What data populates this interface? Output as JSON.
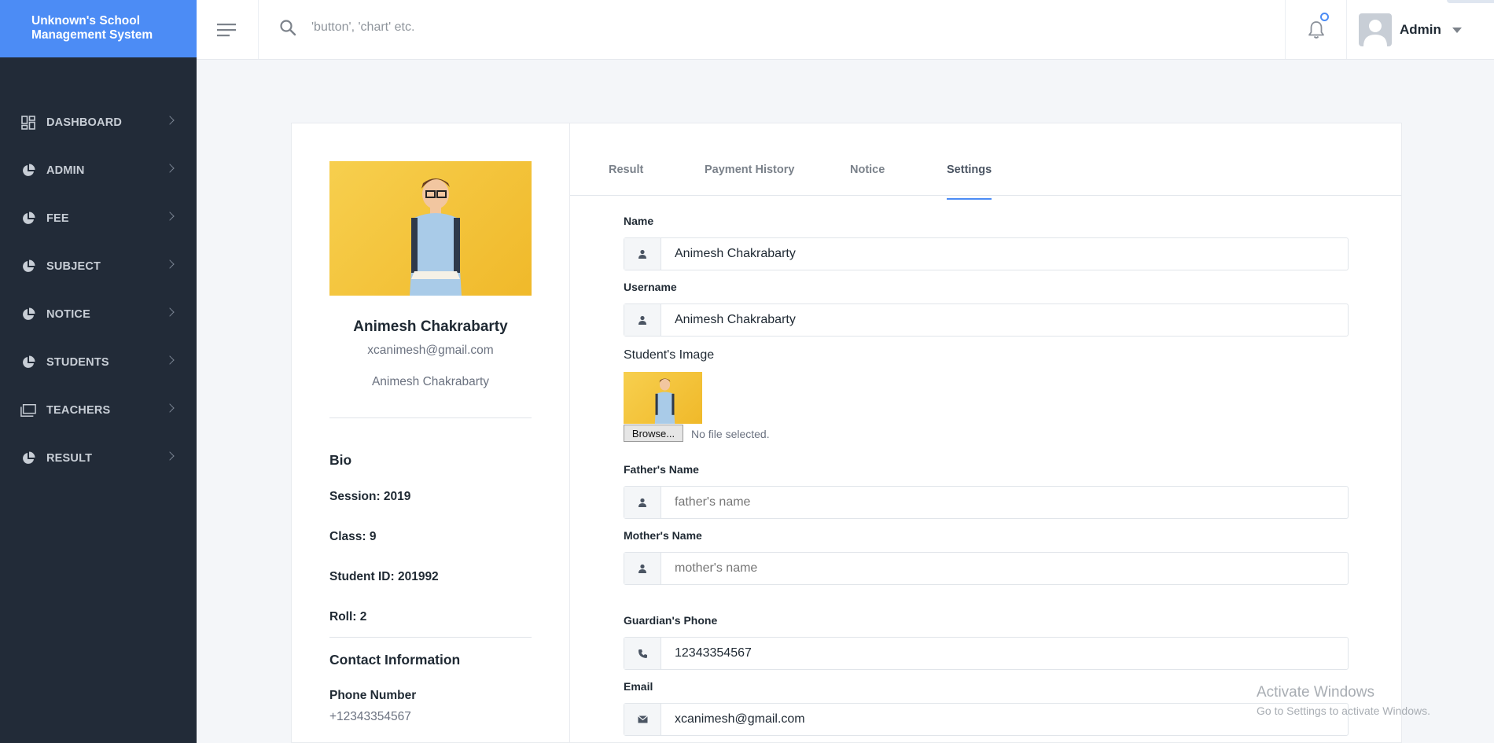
{
  "app": {
    "title_line1": "Unknown's School",
    "title_line2": "Management System"
  },
  "topbar": {
    "search_placeholder": "'button', 'chart' etc.",
    "user_name": "Admin"
  },
  "sidebar": {
    "items": [
      {
        "label": "DASHBOARD",
        "icon": "dashboard-grid-icon"
      },
      {
        "label": "ADMIN",
        "icon": "pie-chart-icon"
      },
      {
        "label": "FEE",
        "icon": "pie-chart-icon"
      },
      {
        "label": "SUBJECT",
        "icon": "pie-chart-icon"
      },
      {
        "label": "NOTICE",
        "icon": "pie-chart-icon"
      },
      {
        "label": "STUDENTS",
        "icon": "pie-chart-icon"
      },
      {
        "label": "TEACHERS",
        "icon": "folders-icon"
      },
      {
        "label": "RESULT",
        "icon": "pie-chart-icon"
      }
    ]
  },
  "profile": {
    "name": "Animesh Chakrabarty",
    "email": "xcanimesh@gmail.com",
    "username": "Animesh Chakrabarty",
    "bio_title": "Bio",
    "session": "Session: 2019",
    "class": "Class: 9",
    "student_id": "Student ID: 201992",
    "roll": "Roll: 2",
    "contact_title": "Contact Information",
    "phone_label": "Phone Number",
    "phone": "+12343354567"
  },
  "tabs": [
    {
      "label": "Result"
    },
    {
      "label": "Payment History"
    },
    {
      "label": "Notice"
    },
    {
      "label": "Settings",
      "active": true
    }
  ],
  "form": {
    "name_label": "Name",
    "name_value": "Animesh Chakrabarty",
    "username_label": "Username",
    "username_value": "Animesh Chakrabarty",
    "image_label": "Student's Image",
    "browse_label": "Browse...",
    "no_file": "No file selected.",
    "father_label": "Father's Name",
    "father_placeholder": "father's name",
    "mother_label": "Mother's Name",
    "mother_placeholder": "mother's name",
    "guardian_phone_label": "Guardian's Phone",
    "guardian_phone_value": "12343354567",
    "email_label": "Email",
    "email_value": "xcanimesh@gmail.com"
  },
  "watermark": {
    "line1": "Activate Windows",
    "line2": "Go to Settings to activate Windows."
  },
  "colors": {
    "brand": "#4c8cf5",
    "sidebar": "#222b38",
    "photo_bg": "#f4c63c"
  }
}
